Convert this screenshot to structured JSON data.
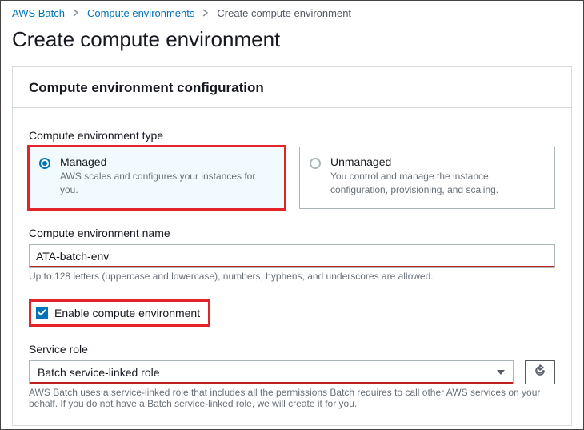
{
  "breadcrumb": {
    "root": "AWS Batch",
    "mid": "Compute environments",
    "current": "Create compute environment"
  },
  "page_title": "Create compute environment",
  "panel": {
    "heading": "Compute environment configuration",
    "env_type": {
      "label": "Compute environment type",
      "managed": {
        "title": "Managed",
        "desc": "AWS scales and configures your instances for you."
      },
      "unmanaged": {
        "title": "Unmanaged",
        "desc": "You control and manage the instance configuration, provisioning, and scaling."
      }
    },
    "env_name": {
      "label": "Compute environment name",
      "value": "ATA-batch-env",
      "help": "Up to 128 letters (uppercase and lowercase), numbers, hyphens, and underscores are allowed."
    },
    "enable": {
      "label": "Enable compute environment"
    },
    "service_role": {
      "label": "Service role",
      "selected": "Batch service-linked role",
      "help": "AWS Batch uses a service-linked role that includes all the permissions Batch requires to call other AWS services on your behalf. If you do not have a Batch service-linked role, we will create it for you."
    }
  }
}
